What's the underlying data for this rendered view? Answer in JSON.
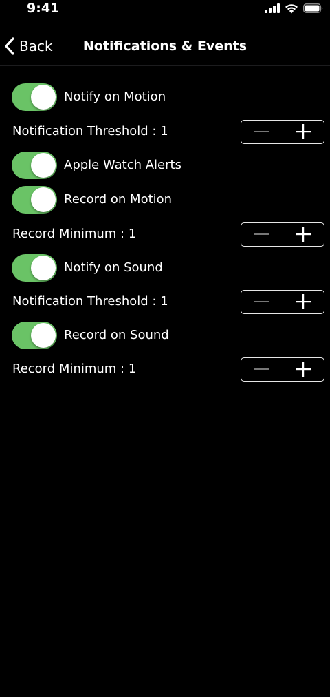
{
  "status_bar": {
    "time": "9:41",
    "icons": [
      "cellular-signal-icon",
      "wifi-icon",
      "battery-icon"
    ]
  },
  "nav": {
    "back_label": "Back",
    "title": "Notifications & Events"
  },
  "toggles": {
    "notify_motion": {
      "label": "Notify on Motion",
      "on": true
    },
    "apple_watch": {
      "label": "Apple Watch Alerts",
      "on": true
    },
    "record_motion": {
      "label": "Record on Motion",
      "on": true
    },
    "notify_sound": {
      "label": "Notify on Sound",
      "on": true
    },
    "record_sound": {
      "label": "Record on Sound",
      "on": true
    }
  },
  "steppers": {
    "motion_threshold": {
      "label": "Notification Threshold : 1"
    },
    "motion_record_min": {
      "label": "Record Minimum : 1"
    },
    "sound_threshold": {
      "label": "Notification Threshold : 1"
    },
    "sound_record_min": {
      "label": "Record Minimum : 1"
    }
  },
  "colors": {
    "toggle_on": "#6ac366",
    "background": "#000000",
    "text": "#ffffff"
  }
}
